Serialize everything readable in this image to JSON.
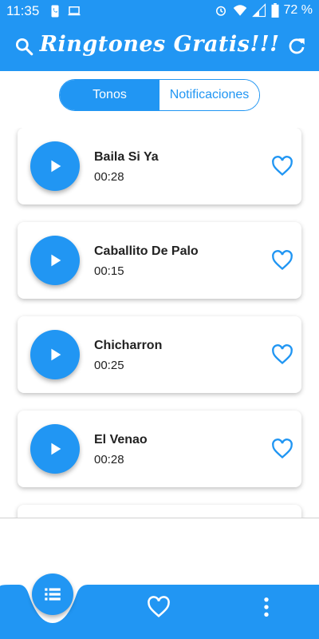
{
  "status_bar": {
    "time": "11:35",
    "battery": "72 %"
  },
  "toolbar": {
    "title": "Ringtones Gratis!!!"
  },
  "tabs": [
    {
      "label": "Tonos",
      "active": true
    },
    {
      "label": "Notificaciones",
      "active": false
    }
  ],
  "ringtones": [
    {
      "name": "Baila Si Ya",
      "duration": "00:28"
    },
    {
      "name": "Caballito De Palo",
      "duration": "00:15"
    },
    {
      "name": "Chicharron",
      "duration": "00:25"
    },
    {
      "name": "El Venao",
      "duration": "00:28"
    }
  ],
  "colors": {
    "accent": "#2196F3",
    "text": "#222222",
    "background": "#FFFFFF"
  },
  "icons": {
    "status": [
      "phone-icon",
      "laptop-icon",
      "alarm-icon",
      "wifi-icon",
      "signal-icon",
      "battery-icon"
    ],
    "toolbar": [
      "search-icon",
      "refresh-icon"
    ],
    "card": [
      "play-icon",
      "heart-outline-icon"
    ],
    "bottom_nav": [
      "list-icon",
      "heart-outline-icon",
      "more-vert-icon"
    ]
  }
}
